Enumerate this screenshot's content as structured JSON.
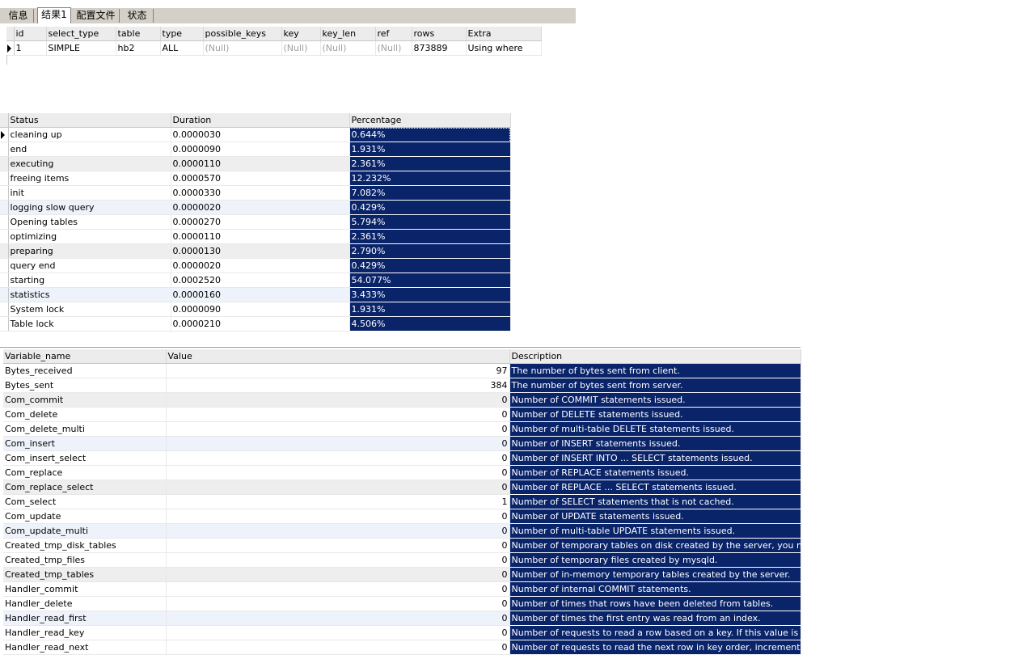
{
  "tabs": [
    "信息",
    "结果1",
    "配置文件",
    "状态"
  ],
  "explain": {
    "headers": [
      "id",
      "select_type",
      "table",
      "type",
      "possible_keys",
      "key",
      "key_len",
      "ref",
      "rows",
      "Extra"
    ],
    "rows": [
      [
        "1",
        "SIMPLE",
        "hb2",
        "ALL",
        "(Null)",
        "(Null)",
        "(Null)",
        "(Null)",
        "873889",
        "Using where"
      ]
    ]
  },
  "profile": {
    "headers": [
      "Status",
      "Duration",
      "Percentage"
    ],
    "rows": [
      [
        "cleaning up",
        "0.0000030",
        "0.644%"
      ],
      [
        "end",
        "0.0000090",
        "1.931%"
      ],
      [
        "executing",
        "0.0000110",
        "2.361%"
      ],
      [
        "freeing items",
        "0.0000570",
        "12.232%"
      ],
      [
        "init",
        "0.0000330",
        "7.082%"
      ],
      [
        "logging slow query",
        "0.0000020",
        "0.429%"
      ],
      [
        "Opening tables",
        "0.0000270",
        "5.794%"
      ],
      [
        "optimizing",
        "0.0000110",
        "2.361%"
      ],
      [
        "preparing",
        "0.0000130",
        "2.790%"
      ],
      [
        "query end",
        "0.0000020",
        "0.429%"
      ],
      [
        "starting",
        "0.0002520",
        "54.077%"
      ],
      [
        "statistics",
        "0.0000160",
        "3.433%"
      ],
      [
        "System lock",
        "0.0000090",
        "1.931%"
      ],
      [
        "Table lock",
        "0.0000210",
        "4.506%"
      ]
    ]
  },
  "status": {
    "headers": [
      "Variable_name",
      "Value",
      "Description"
    ],
    "rows": [
      [
        "Bytes_received",
        "97",
        "The number of bytes sent from client."
      ],
      [
        "Bytes_sent",
        "384",
        "The number of bytes sent from server."
      ],
      [
        "Com_commit",
        "0",
        "Number of COMMIT statements issued."
      ],
      [
        "Com_delete",
        "0",
        "Number of DELETE statements issued."
      ],
      [
        "Com_delete_multi",
        "0",
        "Number of multi-table DELETE statements issued."
      ],
      [
        "Com_insert",
        "0",
        "Number of INSERT statements issued."
      ],
      [
        "Com_insert_select",
        "0",
        "Number of INSERT INTO ... SELECT statements issued."
      ],
      [
        "Com_replace",
        "0",
        "Number of REPLACE statements issued."
      ],
      [
        "Com_replace_select",
        "0",
        "Number of REPLACE ... SELECT statements issued."
      ],
      [
        "Com_select",
        "1",
        "Number of SELECT statements that is not cached."
      ],
      [
        "Com_update",
        "0",
        "Number of UPDATE statements issued."
      ],
      [
        "Com_update_multi",
        "0",
        "Number of multi-table UPDATE statements issued."
      ],
      [
        "Created_tmp_disk_tables",
        "0",
        "Number of temporary tables on disk created by the server, you may want"
      ],
      [
        "Created_tmp_files",
        "0",
        "Number of temporary files created by mysqld."
      ],
      [
        "Created_tmp_tables",
        "0",
        "Number of in-memory temporary tables created by the server."
      ],
      [
        "Handler_commit",
        "0",
        "Number of internal COMMIT statements."
      ],
      [
        "Handler_delete",
        "0",
        "Number of times that rows have been deleted from tables."
      ],
      [
        "Handler_read_first",
        "0",
        "Number of times the first entry was read from an index."
      ],
      [
        "Handler_read_key",
        "0",
        "Number of requests to read a row based on a key. If this value is high, you"
      ],
      [
        "Handler_read_next",
        "0",
        "Number of requests to read the next row in key order, incremented if you"
      ]
    ]
  },
  "colors": {
    "selection": "#0a246a",
    "header": "#ececec",
    "stripe": "#eeeeee",
    "stripe_blue": "#eef3fb"
  }
}
